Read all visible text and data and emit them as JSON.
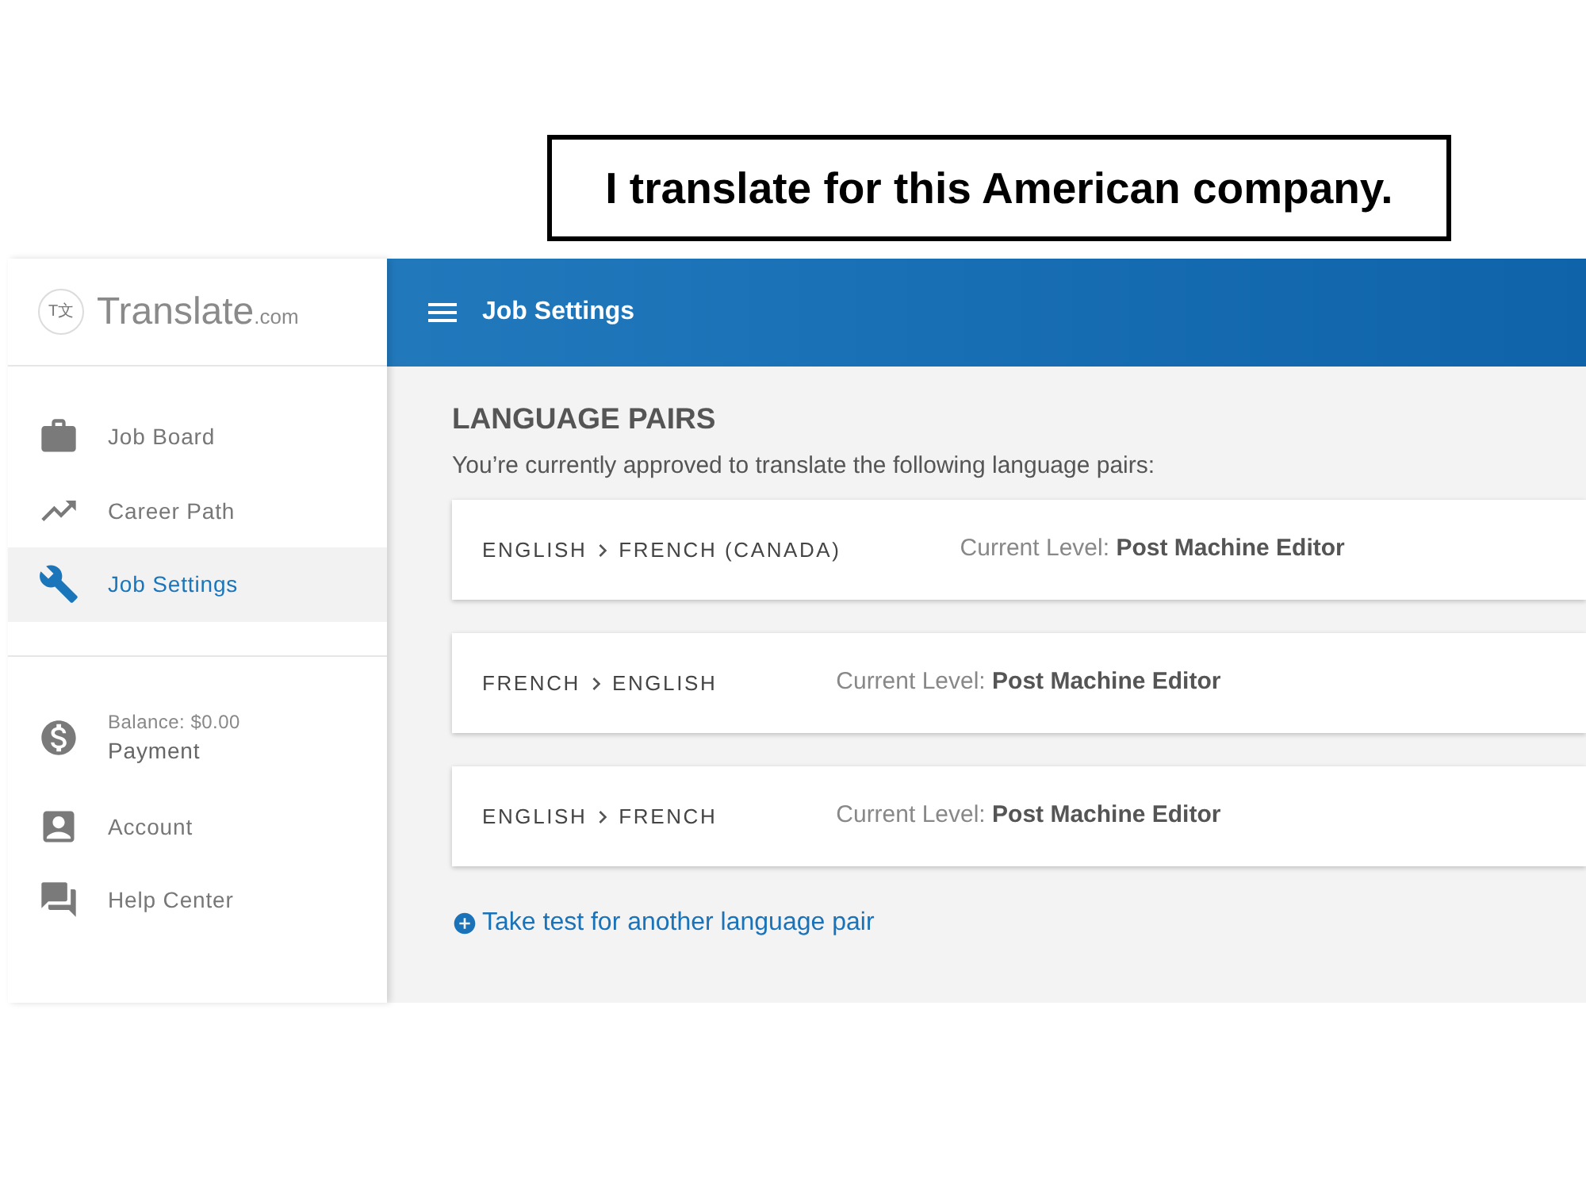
{
  "caption": "I translate for this American company.",
  "sidebar": {
    "logo": {
      "mark": "T文",
      "name": "Translate",
      "suffix": ".com"
    },
    "nav_items": [
      {
        "label": "Job Board",
        "selected": false
      },
      {
        "label": "Career Path",
        "selected": false
      },
      {
        "label": "Job Settings",
        "selected": true
      }
    ],
    "account_items": [
      {
        "sublabel": "Balance: $0.00",
        "label": "Payment",
        "selected": false
      },
      {
        "label": "Account",
        "selected": false
      },
      {
        "label": "Help Center",
        "selected": false
      }
    ]
  },
  "header": {
    "title": "Job Settings"
  },
  "content": {
    "heading": "LANGUAGE PAIRS",
    "description": "You’re currently approved to translate the following language pairs:",
    "language_pairs": [
      {
        "source": "ENGLISH",
        "target": "FRENCH (CANADA)",
        "current_level_label": "Current Level:",
        "current_level": "Post Machine Editor"
      },
      {
        "source": "FRENCH",
        "target": "ENGLISH",
        "current_level_label": "Current Level:",
        "current_level": "Post Machine Editor"
      },
      {
        "source": "ENGLISH",
        "target": "FRENCH",
        "current_level_label": "Current Level:",
        "current_level": "Post Machine Editor"
      }
    ],
    "add_link": "Take test for another language pair"
  }
}
